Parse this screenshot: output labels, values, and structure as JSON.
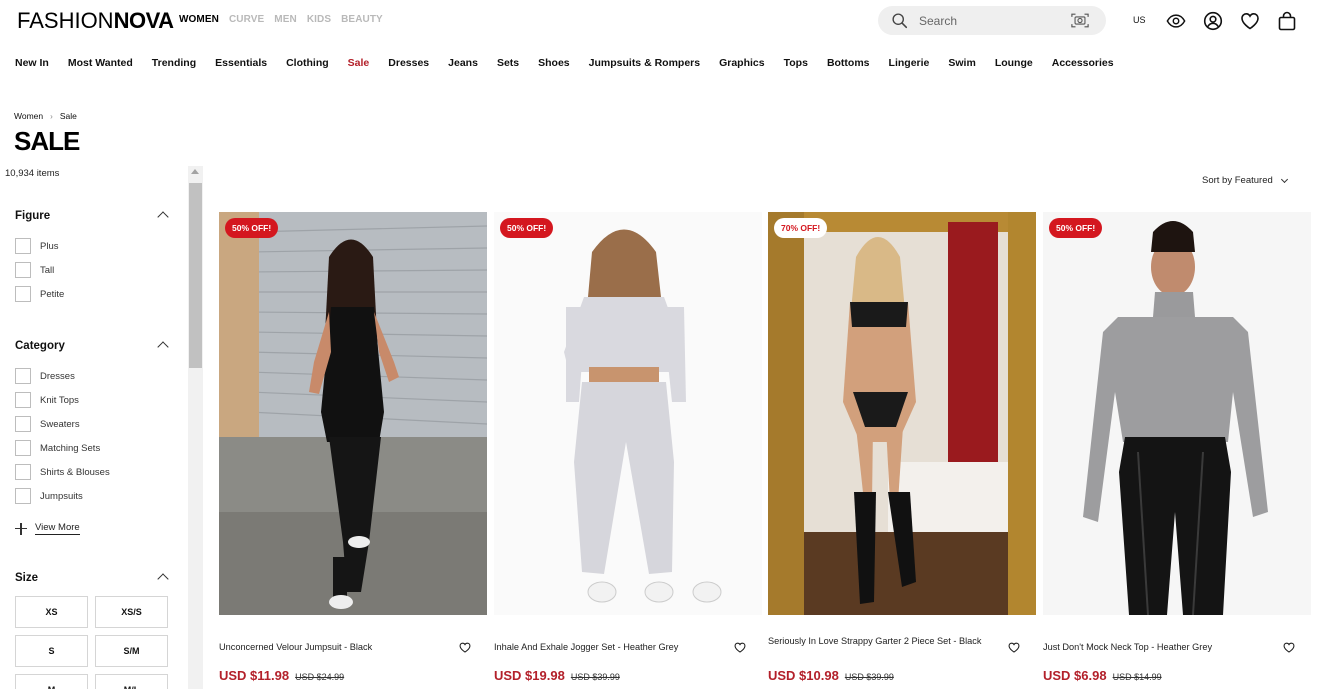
{
  "header": {
    "logo_left": "FASHION",
    "logo_right": "NOVA",
    "tabs": [
      {
        "label": "WOMEN",
        "active": true
      },
      {
        "label": "CURVE",
        "active": false
      },
      {
        "label": "MEN",
        "active": false
      },
      {
        "label": "KIDS",
        "active": false
      },
      {
        "label": "BEAUTY",
        "active": false
      }
    ],
    "search_placeholder": "Search",
    "region": "US",
    "icons": [
      "eye-icon",
      "account-icon",
      "heart-icon",
      "bag-icon"
    ]
  },
  "nav": {
    "items": [
      "New In",
      "Most Wanted",
      "Trending",
      "Essentials",
      "Clothing",
      "Sale",
      "Dresses",
      "Jeans",
      "Sets",
      "Shoes",
      "Jumpsuits & Rompers",
      "Graphics",
      "Tops",
      "Bottoms",
      "Lingerie",
      "Swim",
      "Lounge",
      "Accessories"
    ],
    "active": "Sale"
  },
  "breadcrumb": [
    "Women",
    "Sale"
  ],
  "page": {
    "title": "SALE",
    "count": "10,934 items",
    "sort_label": "Sort by Featured"
  },
  "filters": {
    "figure": {
      "title": "Figure",
      "options": [
        "Plus",
        "Tall",
        "Petite"
      ]
    },
    "category": {
      "title": "Category",
      "options": [
        "Dresses",
        "Knit Tops",
        "Sweaters",
        "Matching Sets",
        "Shirts & Blouses",
        "Jumpsuits"
      ],
      "view_more": "View More"
    },
    "size": {
      "title": "Size",
      "options": [
        "XS",
        "XS/S",
        "S",
        "S/M",
        "M",
        "M/L"
      ]
    }
  },
  "products": [
    {
      "name": "Unconcerned Velour Jumpsuit - Black",
      "price": "USD $11.98",
      "was": "USD $24.99",
      "badge": "50% OFF!"
    },
    {
      "name": "Inhale And Exhale Jogger Set - Heather Grey",
      "price": "USD $19.98",
      "was": "USD $39.99",
      "badge": "50% OFF!"
    },
    {
      "name": "Seriously In Love Strappy Garter 2 Piece Set - Black",
      "price": "USD $10.98",
      "was": "USD $39.99",
      "badge": "70% OFF!"
    },
    {
      "name": "Just Don't Mock Neck Top - Heather Grey",
      "price": "USD $6.98",
      "was": "USD $14.99",
      "badge": "50% OFF!"
    }
  ],
  "colors": {
    "sale_red": "#b3202a",
    "badge_red": "#d4171f"
  }
}
